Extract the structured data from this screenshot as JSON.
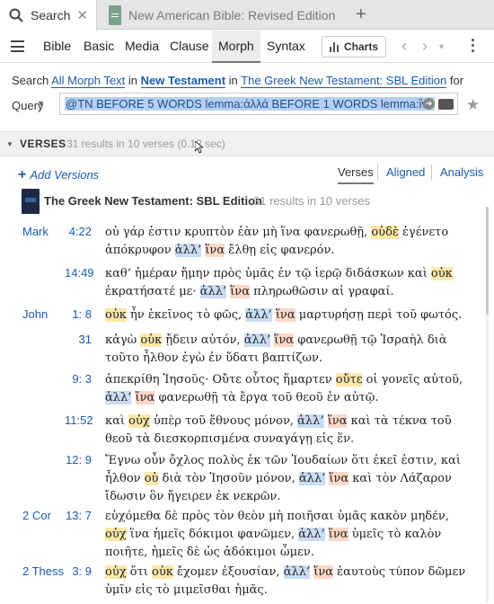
{
  "tabs": [
    {
      "title": "Search",
      "active": true
    },
    {
      "title": "New American Bible: Revised Edition",
      "active": false
    }
  ],
  "nav": {
    "items": [
      "Bible",
      "Basic",
      "Media",
      "Clause",
      "Morph",
      "Syntax"
    ],
    "selected": "Morph",
    "charts_label": "Charts"
  },
  "search": {
    "prefix": "Search",
    "scope_label": "All Morph Text",
    "in1": "in",
    "range_label": "New Testament",
    "in2": "in",
    "resource_label": "The Greek New Testament: SBL Edition",
    "for": "for",
    "query_label": "Query",
    "query_value": "@TN BEFORE 5 WORDS lemma:ἀλλά  BEFORE 1 WORDS lemma:ἵνα"
  },
  "verses_header": {
    "label": "VERSES",
    "count": "31 results in 10 verses (0.12 sec)"
  },
  "subheader": {
    "add_versions": "Add Versions",
    "views": [
      "Verses",
      "Aligned",
      "Analysis"
    ],
    "selected_view": "Verses"
  },
  "edition": {
    "title": "The Greek New Testament: SBL Edition",
    "count": "31 results in 10 verses"
  },
  "colors": {
    "link": "#1a5cad",
    "hl_neg": "#fde7a9",
    "hl_alla": "#c9dcf2",
    "hl_hina": "#fbd7c6"
  },
  "results": [
    {
      "book": "Mark",
      "ref": "4:22",
      "html": "οὐ γάρ ἐστιν κρυπτὸν ἐὰν μὴ ἵνα φανερωθῇ, <span class='hw'>οὐδὲ</span> ἐγένετο ἀπόκρυφον <span class='hb'>ἀλλ’</span> <span class='hr'>ἵνα</span> ἔλθῃ εἰς φανερόν."
    },
    {
      "book": "",
      "ref": "14:49",
      "html": "καθ’ ἡμέραν ἤμην πρὸς ὑμᾶς ἐν τῷ ἱερῷ διδάσκων καὶ <span class='hw'>οὐκ</span> ἐκρατήσατέ με· <span class='hb'>ἀλλ’</span> <span class='hr'>ἵνα</span> πληρωθῶσιν αἱ γραφαί."
    },
    {
      "book": "John",
      "ref": "1: 8",
      "html": "<span class='hw'>οὐκ</span> ἦν ἐκεῖνος τὸ φῶς, <span class='hb'>ἀλλ’</span> <span class='hr'>ἵνα</span> μαρτυρήσῃ περὶ τοῦ φωτός."
    },
    {
      "book": "",
      "ref": "31",
      "html": "κἀγὼ <span class='hw'>οὐκ</span> ᾔδειν αὐτόν, <span class='hb'>ἀλλ’</span> <span class='hr'>ἵνα</span> φανερωθῇ τῷ Ἰσραὴλ διὰ τοῦτο ἦλθον ἐγὼ ἐν ὕδατι βαπτίζων."
    },
    {
      "book": "",
      "ref": "9: 3",
      "html": "ἀπεκρίθη Ἰησοῦς· Οὔτε οὗτος ἥμαρτεν <span class='hw'>οὔτε</span> οἱ γονεῖς αὐτοῦ, <span class='hb'>ἀλλ’</span> <span class='hr'>ἵνα</span> φανερωθῇ τὰ ἔργα τοῦ θεοῦ ἐν αὐτῷ."
    },
    {
      "book": "",
      "ref": "11:52",
      "html": "καὶ <span class='hw'>οὐχ</span> ὑπὲρ τοῦ ἔθνους μόνον, <span class='hb'>ἀλλ’</span> <span class='hr'>ἵνα</span> καὶ τὰ τέκνα τοῦ θεοῦ τὰ διεσκορπισμένα συναγάγῃ εἰς ἕν."
    },
    {
      "book": "",
      "ref": "12: 9",
      "html": "Ἔγνω οὖν ὄχλος πολὺς ἐκ τῶν Ἰουδαίων ὅτι ἐκεῖ ἐστιν, καὶ ἦλθον <span class='hw'>οὐ</span> διὰ τὸν Ἰησοῦν μόνον, <span class='hb'>ἀλλ’</span> <span class='hr'>ἵνα</span> καὶ τὸν Λάζαρον ἴδωσιν ὃν ἤγειρεν ἐκ νεκρῶν."
    },
    {
      "book": "2 Cor",
      "ref": "13: 7",
      "html": "εὐχόμεθα δὲ πρὸς τὸν θεὸν μὴ ποιῆσαι ὑμᾶς κακὸν μηδέν, <span class='hw'>οὐχ</span> ἵνα ἡμεῖς δόκιμοι φανῶμεν, <span class='hb'>ἀλλ’</span> <span class='hr'>ἵνα</span> ὑμεῖς τὸ καλὸν ποιῆτε, ἡμεῖς δὲ ὡς ἀδόκιμοι ὦμεν."
    },
    {
      "book": "2 Thess",
      "ref": "3: 9",
      "html": "<span class='hw'>οὐχ</span> ὅτι <span class='hw'>οὐκ</span> ἔχομεν ἐξουσίαν, <span class='hb'>ἀλλ’</span> <span class='hr'>ἵνα</span> ἑαυτοὺς τύπον δῶμεν ὑμῖν εἰς τὸ μιμεῖσθαι ἡμᾶς."
    }
  ]
}
